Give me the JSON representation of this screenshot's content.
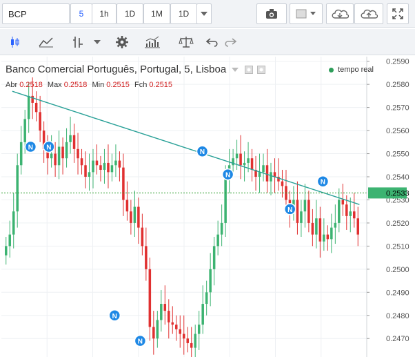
{
  "toolbar": {
    "symbol": "BCP",
    "interval_active": "5",
    "intervals": [
      "5",
      "1h",
      "1D",
      "1M",
      "1D"
    ]
  },
  "legend": {
    "title": "Banco Comercial Português, Portugal, 5, Lisboa",
    "open_label": "Abr",
    "open_value": "0.2518",
    "high_label": "Max",
    "high_value": "0.2518",
    "low_label": "Min",
    "low_value": "0.2515",
    "close_label": "Fch",
    "close_value": "0.2515",
    "realtime": "tempo real"
  },
  "colors": {
    "up": "#3cb371",
    "down": "#e03030",
    "trend": "#2aa198",
    "price_line": "#2a9d2a",
    "news": "#1e88e5"
  },
  "chart_data": {
    "type": "candlestick",
    "title": "Banco Comercial Português, Portugal, 5, Lisboa",
    "ylim": [
      0.2462,
      0.2592
    ],
    "y_ticks": [
      "0.2590",
      "0.2580",
      "0.2570",
      "0.2560",
      "0.2550",
      "0.2540",
      "0.2530",
      "0.2520",
      "0.2510",
      "0.2500",
      "0.2490",
      "0.2480",
      "0.2470"
    ],
    "current_price": "0.2533",
    "close_series": [
      0.251,
      0.2515,
      0.2525,
      0.2545,
      0.2555,
      0.2565,
      0.2575,
      0.2572,
      0.2568,
      0.256,
      0.2552,
      0.2548,
      0.255,
      0.2545,
      0.2553,
      0.2548,
      0.2555,
      0.2558,
      0.2552,
      0.2548,
      0.2545,
      0.254,
      0.2542,
      0.2547,
      0.2545,
      0.2543,
      0.2546,
      0.2542,
      0.2545,
      0.2547,
      0.2544,
      0.253,
      0.2525,
      0.252,
      0.2527,
      0.2518,
      0.251,
      0.25,
      0.2475,
      0.247,
      0.2478,
      0.2485,
      0.2482,
      0.2477,
      0.2476,
      0.2474,
      0.2472,
      0.247,
      0.2468,
      0.2466,
      0.2472,
      0.2476,
      0.2485,
      0.249,
      0.25,
      0.251,
      0.2515,
      0.252,
      0.254,
      0.2545,
      0.2548,
      0.255,
      0.2545,
      0.2546,
      0.2548,
      0.2543,
      0.254,
      0.2542,
      0.2545,
      0.2538,
      0.2542,
      0.254,
      0.2538,
      0.2536,
      0.253,
      0.2525,
      0.253,
      0.252,
      0.2525,
      0.253,
      0.252,
      0.2515,
      0.2522,
      0.2512,
      0.2515,
      0.2513,
      0.2518,
      0.252,
      0.253,
      0.2528,
      0.2523,
      0.2525,
      0.2522,
      0.2515
    ],
    "trend_line": {
      "start": [
        0.03,
        0.2577
      ],
      "end": [
        0.98,
        0.2528
      ]
    },
    "news_markers": [
      {
        "pos": 0.08,
        "price": 0.2553
      },
      {
        "pos": 0.13,
        "price": 0.2553
      },
      {
        "pos": 0.31,
        "price": 0.248
      },
      {
        "pos": 0.38,
        "price": 0.2469
      },
      {
        "pos": 0.55,
        "price": 0.2551
      },
      {
        "pos": 0.62,
        "price": 0.2541
      },
      {
        "pos": 0.79,
        "price": 0.2526
      },
      {
        "pos": 0.88,
        "price": 0.2538
      }
    ],
    "news_label": "N"
  }
}
